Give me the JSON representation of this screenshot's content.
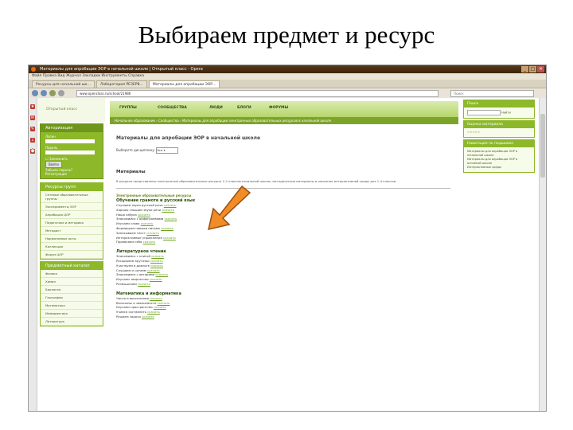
{
  "slide": {
    "title": "Выбираем предмет и ресурс"
  },
  "browser": {
    "window_title": "Материалы для апробации ЭОР в начальной школе | Открытый класс - Opera",
    "menu": "Файл  Правка  Вид  Журнал  Закладки  Инструменты  Справка",
    "tabs": [
      "Ресурсы для начальной шк...",
      "Лаборатория РЕЗЕРВ...",
      "Материалы для апробации ЭОР..."
    ],
    "url": "www.openclass.ru/school/21986",
    "search_placeholder": "Поиск"
  },
  "site": {
    "logo_text": "Открытый класс",
    "topnav": [
      "ГРУППЫ",
      "СООБЩЕСТВА",
      "ЛЮДИ",
      "БЛОГИ",
      "ФОРУМЫ"
    ],
    "breadcrumb": "Начальное образование  ›  Сообщества  ›  Материалы для апробации электронных образовательных ресурсов в начальной школе",
    "auth": {
      "title": "Авторизация",
      "login_label": "Логин",
      "password_label": "Пароль",
      "remember": "Запомнить",
      "button": "Войти",
      "links": [
        "Забыли пароль?",
        "Регистрация"
      ]
    },
    "group_box": {
      "title": "Ресурсы групп",
      "items": [
        "Сетевые образовательные группы",
        "Эксперименты ЭОР",
        "Апробация ЦОР",
        "Педагогика и методика",
        "Методист",
        "Нормативные акты",
        "Коллекции",
        "Форум ЦОР"
      ]
    },
    "subject_box": {
      "title": "Предметный каталог",
      "items": [
        "Физика",
        "Химия",
        "Биология",
        "География",
        "Математика",
        "Информатика",
        "Литература"
      ]
    }
  },
  "main": {
    "page_title": "Материалы для апробации ЭОР в начальной школе",
    "select_label": "Выберите дисциплину:",
    "select_value": "Все",
    "materials_title": "Материалы",
    "intro": "В разделе представлены электронные образовательные ресурсы 1-2 классов начальной школы, методические материалы и описание интерактивной среды для 1-4 классов.",
    "sections": [
      {
        "caption": "Электронные образовательные ресурсы",
        "subtitle": "Обучение грамоте и русский язык",
        "lines": [
          {
            "text": "Слушаем звуки русской речи",
            "link": "скачать"
          },
          {
            "text": "Хорошо слышим звуки речи",
            "link": "скачать"
          },
          {
            "text": "Наша азбука",
            "link": "скачать"
          },
          {
            "text": "Знакомимся с орфограммами",
            "link": "скачать"
          },
          {
            "text": "Изучаем слово",
            "link": "скачать"
          },
          {
            "text": "Формируем навыки письма",
            "link": "скачать"
          },
          {
            "text": "Записываем текст",
            "link": "скачать"
          },
          {
            "text": "Интерактивные упражнения",
            "link": "скачать"
          },
          {
            "text": "Проверяем себя",
            "link": "скачать"
          }
        ]
      },
      {
        "caption": "",
        "subtitle": "Литературное чтение",
        "lines": [
          {
            "text": "Знакомимся с книгой",
            "link": "скачать"
          },
          {
            "text": "Расширяем кругозор",
            "link": "скачать"
          },
          {
            "text": "Участвуем в диалоге",
            "link": "скачать"
          },
          {
            "text": "Слушаем и читаем",
            "link": "скачать"
          },
          {
            "text": "Знакомимся с авторами",
            "link": "скачать"
          },
          {
            "text": "Изучаем творчество",
            "link": "скачать"
          },
          {
            "text": "Размышляем",
            "link": "скачать"
          }
        ]
      },
      {
        "caption": "",
        "subtitle": "Математика и информатика",
        "lines": [
          {
            "text": "Числа и вычисления",
            "link": "скачать"
          },
          {
            "text": "Величины и зависимости",
            "link": "скачать"
          },
          {
            "text": "Изучаем пространство",
            "link": "скачать"
          },
          {
            "text": "Учимся составлять",
            "link": "скачать"
          },
          {
            "text": "Решаем задачи",
            "link": "скачать"
          }
        ]
      }
    ]
  },
  "right": {
    "search": {
      "title": "Поиск",
      "button": "Найти"
    },
    "rating": {
      "title": "Оценка материала"
    },
    "nav": {
      "title": "Навигация по подшивке",
      "items": [
        "Материалы для апробации ЭОР в начальной школе",
        "Материалы для апробации ЭОР в основной школе",
        "Интерактивные среды"
      ]
    }
  },
  "colors": {
    "accent": "#8cb82a",
    "arrow": "#f28c28"
  }
}
